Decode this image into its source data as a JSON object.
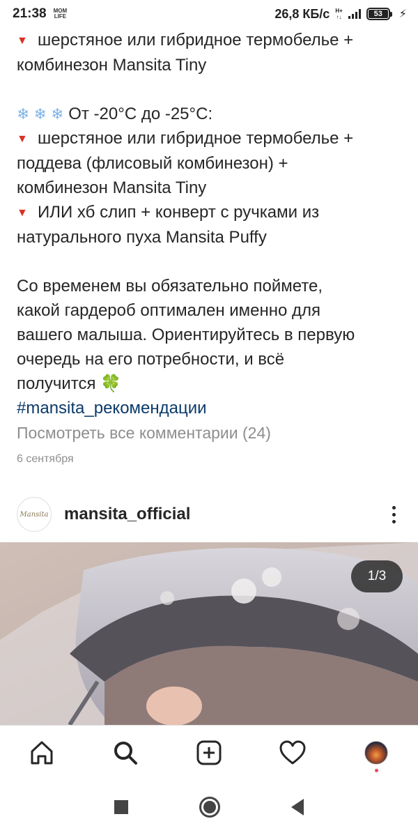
{
  "status_bar": {
    "time": "21:38",
    "carrier_badge_top": "MOM",
    "carrier_badge_bottom": "LIFE",
    "net_speed": "26,8 КБ/с",
    "net_type_top": "H+",
    "net_type_bottom": "↑↓",
    "battery": "53"
  },
  "caption": {
    "line1": "шерстяное или гибридное термобелье  +",
    "line2": "комбинезон Mansita Tiny",
    "range_icons": "❄ ❄ ❄",
    "range": " От -20°C до -25°C:",
    "item1_a": "шерстяное или гибридное термобелье +",
    "item1_b": "поддева (флисовый комбинезон) +",
    "item1_c": "комбинезон Mansita Tiny",
    "item2_a": "ИЛИ хб слип + конверт с ручками из",
    "item2_b": "натурального пуха Mansita Puffy",
    "para_1": "Со временем вы обязательно поймете,",
    "para_2": "какой гардероб оптимален именно для",
    "para_3": "вашего малыша. Ориентируйтесь в первую",
    "para_4": "очередь на его потребности, и всё",
    "para_5": "получится",
    "clover": "🍀",
    "hashtag": "#mansita_рекомендации",
    "triangle": "▼"
  },
  "view_comments": "Посмотреть все комментарии (24)",
  "date": "6 сентября",
  "post": {
    "avatar_text": "Mansita",
    "username": "mansita_official",
    "counter": "1/3"
  },
  "colors": {
    "accent_red": "#d93025",
    "hashtag": "#0b3a6a",
    "muted": "#8e8e8e"
  },
  "icons": {
    "nav": [
      "home-icon",
      "search-icon",
      "new-post-icon",
      "activity-heart-icon",
      "profile-avatar"
    ],
    "system": [
      "recents-icon",
      "home-circle-icon",
      "back-icon"
    ]
  }
}
